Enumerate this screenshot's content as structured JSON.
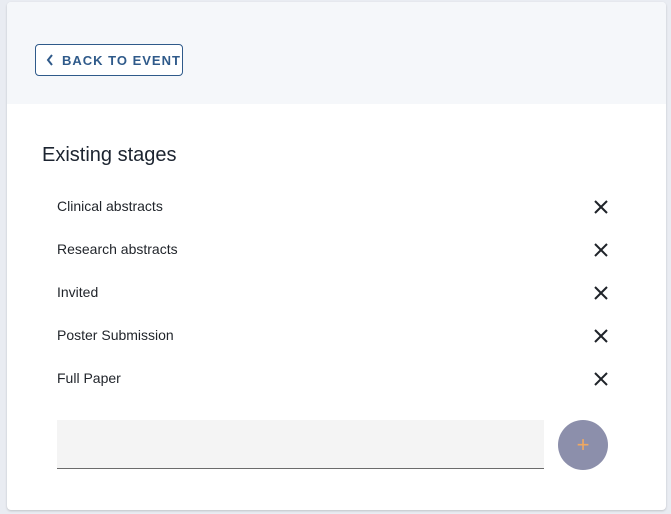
{
  "header": {
    "back_label": "BACK TO EVENT"
  },
  "main": {
    "title": "Existing stages",
    "stages": [
      {
        "label": "Clinical abstracts"
      },
      {
        "label": "Research abstracts"
      },
      {
        "label": "Invited"
      },
      {
        "label": "Poster Submission"
      },
      {
        "label": "Full Paper"
      }
    ],
    "new_stage": {
      "value": "",
      "placeholder": ""
    },
    "add_symbol": "+"
  },
  "icons": {
    "back": "chevron-left-icon",
    "remove": "close-icon",
    "add": "plus-icon"
  },
  "colors": {
    "accent": "#2f5a8a",
    "fab_bg": "#8c8fab",
    "fab_plus": "#f0a860"
  }
}
